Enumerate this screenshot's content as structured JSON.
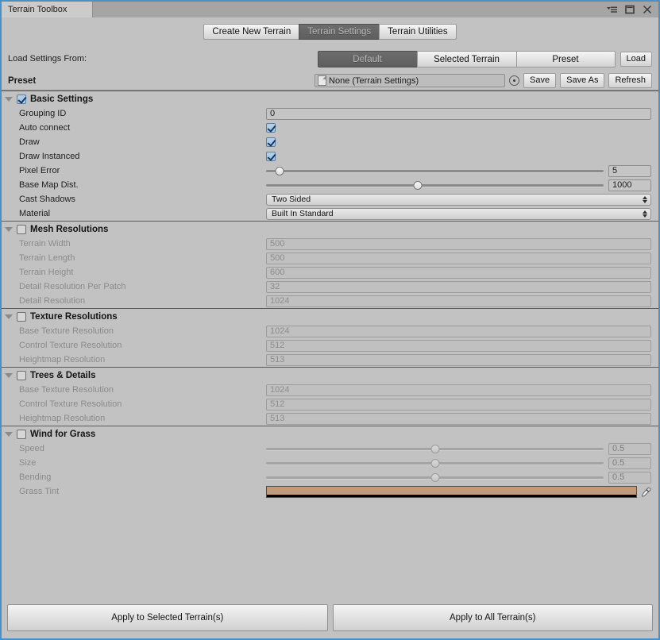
{
  "window": {
    "tab_title": "Terrain Toolbox",
    "controls": [
      {
        "name": "window-menu-icon",
        "glyph": "≡"
      },
      {
        "name": "maximize-icon",
        "glyph": "□"
      },
      {
        "name": "close-icon",
        "glyph": "✕"
      }
    ]
  },
  "toolbar": {
    "tabs": [
      {
        "label": "Create New Terrain",
        "selected": false
      },
      {
        "label": "Terrain Settings",
        "selected": true
      },
      {
        "label": "Terrain Utilities",
        "selected": false
      }
    ]
  },
  "load_settings": {
    "label": "Load Settings From:",
    "options": [
      {
        "label": "Default",
        "selected": true
      },
      {
        "label": "Selected Terrain",
        "selected": false
      },
      {
        "label": "Preset",
        "selected": false
      }
    ],
    "load_button": "Load"
  },
  "preset": {
    "label": "Preset",
    "object_value": "None (Terrain Settings)",
    "buttons": [
      "Save",
      "Save As",
      "Refresh"
    ]
  },
  "sections": [
    {
      "name": "basic-settings",
      "title": "Basic Settings",
      "checked": true,
      "enabled": true,
      "rows": [
        {
          "label": "Grouping ID",
          "type": "text",
          "value": "0"
        },
        {
          "label": "Auto connect",
          "type": "checkbox",
          "checked": true
        },
        {
          "label": "Draw",
          "type": "checkbox",
          "checked": true
        },
        {
          "label": "Draw Instanced",
          "type": "checkbox",
          "checked": true
        },
        {
          "label": "Pixel Error",
          "type": "slider",
          "value": "5",
          "percent": 4
        },
        {
          "label": "Base Map Dist.",
          "type": "slider",
          "value": "1000",
          "percent": 45
        },
        {
          "label": "Cast Shadows",
          "type": "popup",
          "value": "Two Sided"
        },
        {
          "label": "Material",
          "type": "popup",
          "value": "Built In Standard"
        }
      ]
    },
    {
      "name": "mesh-resolutions",
      "title": "Mesh Resolutions",
      "checked": false,
      "enabled": false,
      "rows": [
        {
          "label": "Terrain Width",
          "type": "text",
          "value": "500"
        },
        {
          "label": "Terrain Length",
          "type": "text",
          "value": "500"
        },
        {
          "label": "Terrain Height",
          "type": "text",
          "value": "600"
        },
        {
          "label": "Detail Resolution Per Patch",
          "type": "text",
          "value": "32"
        },
        {
          "label": "Detail Resolution",
          "type": "text",
          "value": "1024"
        }
      ]
    },
    {
      "name": "texture-resolutions",
      "title": "Texture Resolutions",
      "checked": false,
      "enabled": false,
      "rows": [
        {
          "label": "Base Texture Resolution",
          "type": "text",
          "value": "1024"
        },
        {
          "label": "Control Texture Resolution",
          "type": "text",
          "value": "512"
        },
        {
          "label": "Heightmap Resolution",
          "type": "text",
          "value": "513"
        }
      ]
    },
    {
      "name": "trees-and-details",
      "title": "Trees & Details",
      "checked": false,
      "enabled": false,
      "rows": [
        {
          "label": "Base Texture Resolution",
          "type": "text",
          "value": "1024"
        },
        {
          "label": "Control Texture Resolution",
          "type": "text",
          "value": "512"
        },
        {
          "label": "Heightmap Resolution",
          "type": "text",
          "value": "513"
        }
      ]
    },
    {
      "name": "wind-for-grass",
      "title": "Wind for Grass",
      "checked": false,
      "enabled": false,
      "rows": [
        {
          "label": "Speed",
          "type": "slider",
          "value": "0.5",
          "percent": 50
        },
        {
          "label": "Size",
          "type": "slider",
          "value": "0.5",
          "percent": 50
        },
        {
          "label": "Bending",
          "type": "slider",
          "value": "0.5",
          "percent": 50
        },
        {
          "label": "Grass Tint",
          "type": "color",
          "color": "#c09a7b",
          "alpha_color": "#000000"
        }
      ]
    }
  ],
  "footer": {
    "apply_selected": "Apply to Selected Terrain(s)",
    "apply_all": "Apply to All Terrain(s)"
  }
}
